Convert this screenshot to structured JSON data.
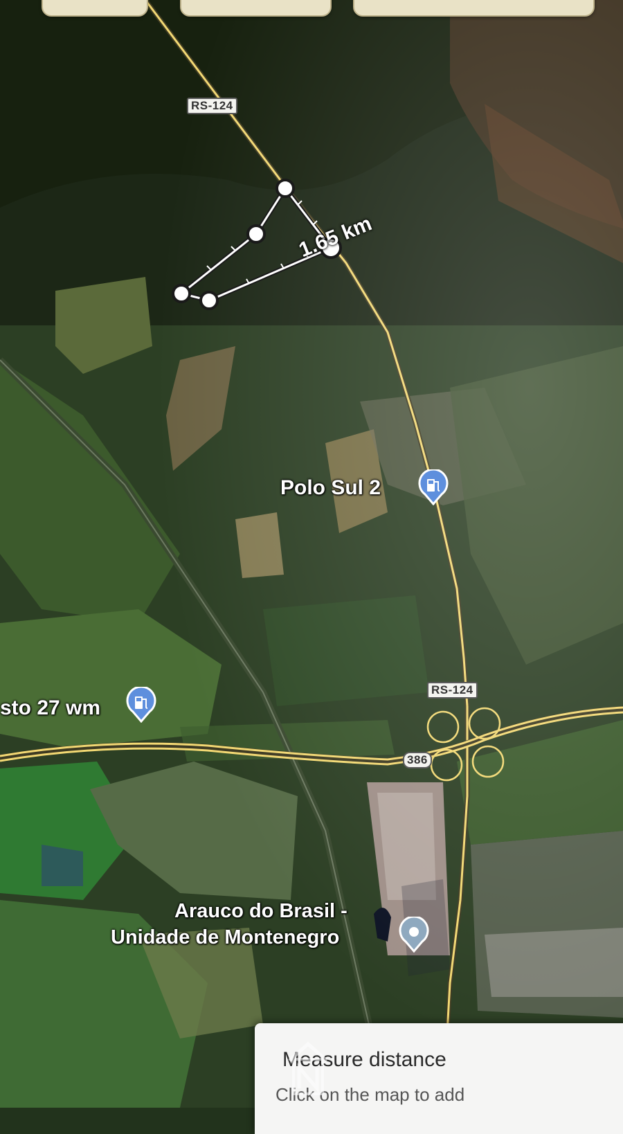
{
  "map": {
    "type": "satellite",
    "measure_distance_label": "1.65 km",
    "road_labels": {
      "rs124_north": "RS-124",
      "rs124_south": "RS-124",
      "br386": "386"
    },
    "places": {
      "polo_sul_2": "Polo Sul 2",
      "posto_27": "sto 27 wm",
      "arauco_line1": "Arauco do Brasil -",
      "arauco_line2": "Unidade de Montenegro"
    }
  },
  "measure_panel": {
    "title": "Measure distance",
    "subtitle": "Click on the map to add"
  },
  "icons": {
    "gas_station": "gas-station-icon",
    "place": "place-pin-icon"
  },
  "colors": {
    "road": "#f2d873",
    "pin_blue": "#5e8fdd",
    "pin_grey": "#8fa9bf"
  }
}
